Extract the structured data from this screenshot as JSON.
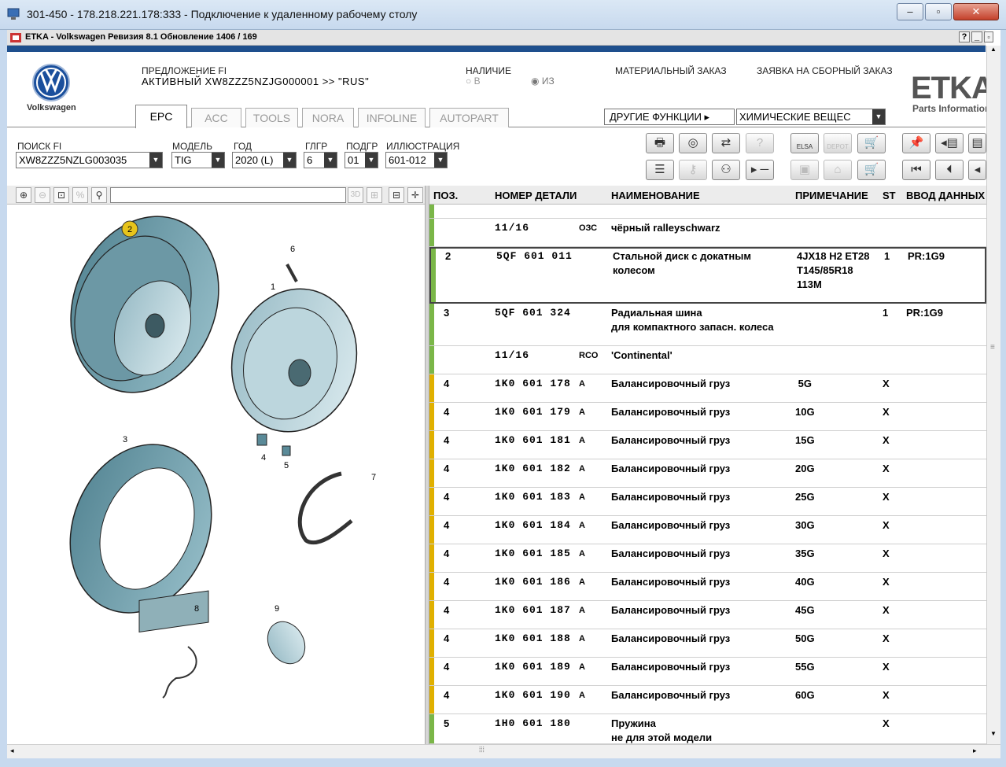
{
  "window": {
    "title": "301-450 - 178.218.221.178:333 - Подключение к удаленному рабочему столу"
  },
  "app": {
    "title": "ETKA - Volkswagen Ревизия 8.1 Обновление 1406 / 169",
    "help": "?",
    "minimize": "_",
    "maximize": "▫"
  },
  "brand": {
    "logo_text": "Volkswagen",
    "etka": "ETKA",
    "etka_sub": "Parts Information"
  },
  "header": {
    "offer_label": "ПРЕДЛОЖЕНИЕ FI",
    "offer_value": "АКТИВНЫЙ XW8ZZZ5NZJG000001 >> \"RUS\"",
    "availability_label": "НАЛИЧИЕ",
    "radio_v": "В",
    "radio_iz": "ИЗ",
    "material_order": "МАТЕРИАЛЬНЫЙ ЗАКАЗ",
    "assembly_order": "ЗАЯВКА НА СБОРНЫЙ ЗАКАЗ",
    "other_functions": "ДРУГИЕ ФУНКЦИИ ▸",
    "chemicals": "ХИМИЧЕСКИЕ ВЕЩЕС"
  },
  "tabs": [
    "EPC",
    "ACC",
    "TOOLS",
    "NORA",
    "INFOLINE",
    "AUTOPART"
  ],
  "search": {
    "fi_label": "ПОИСК FI",
    "fi_value": "XW8ZZZ5NZLG003035",
    "model_label": "МОДЕЛЬ",
    "model_value": "TIG",
    "year_label": "ГОД",
    "year_value": "2020 (L)",
    "glgr_label": "ГЛГР",
    "glgr_value": "6",
    "podgr_label": "ПОДГР",
    "podgr_value": "01",
    "ill_label": "ИЛЛЮСТРАЦИЯ",
    "ill_value": "601-012"
  },
  "toolbar": {
    "elsa": "ELSA",
    "depot": "DEPOT"
  },
  "columns": {
    "pos": "ПОЗ.",
    "part": "НОМЕР ДЕТАЛИ",
    "name": "НАИМЕНОВАНИЕ",
    "note": "ПРИМЕЧАНИЕ",
    "st": "ST",
    "entry": "ВВОД ДАННЫХ"
  },
  "rows": [
    {
      "pos": "",
      "part": "",
      "code": "",
      "name": "",
      "note": "",
      "st": "",
      "entry": ""
    },
    {
      "pos": "",
      "part": "11/16",
      "code": "ОЗС",
      "name": "чёрный ralleyschwarz",
      "note": "",
      "st": "",
      "entry": ""
    },
    {
      "pos": "2",
      "part": "5QF 601 011",
      "code": "",
      "name": "Стальной диск с докатным",
      "name2": "колесом",
      "note": "4JX18 H2 ET28",
      "note2": "T145/85R18",
      "note3": "113M",
      "st": "1",
      "entry": "PR:1G9"
    },
    {
      "pos": "3",
      "part": "5QF 601 324",
      "code": "",
      "name": "Радиальная шина",
      "name2": "для компактного запасн. колеса",
      "note": "",
      "st": "1",
      "entry": "PR:1G9"
    },
    {
      "pos": "",
      "part": "11/16",
      "code": "RCO",
      "name": "'Continental'",
      "note": "",
      "st": "",
      "entry": ""
    },
    {
      "pos": "4",
      "part": "1K0 601 178",
      "code": "A",
      "name": "Балансировочный груз",
      "note": " 5G",
      "st": "X",
      "entry": ""
    },
    {
      "pos": "4",
      "part": "1K0 601 179",
      "code": "A",
      "name": "Балансировочный груз",
      "note": "10G",
      "st": "X",
      "entry": ""
    },
    {
      "pos": "4",
      "part": "1K0 601 181",
      "code": "A",
      "name": "Балансировочный груз",
      "note": "15G",
      "st": "X",
      "entry": ""
    },
    {
      "pos": "4",
      "part": "1K0 601 182",
      "code": "A",
      "name": "Балансировочный груз",
      "note": "20G",
      "st": "X",
      "entry": ""
    },
    {
      "pos": "4",
      "part": "1K0 601 183",
      "code": "A",
      "name": "Балансировочный груз",
      "note": "25G",
      "st": "X",
      "entry": ""
    },
    {
      "pos": "4",
      "part": "1K0 601 184",
      "code": "A",
      "name": "Балансировочный груз",
      "note": "30G",
      "st": "X",
      "entry": ""
    },
    {
      "pos": "4",
      "part": "1K0 601 185",
      "code": "A",
      "name": "Балансировочный груз",
      "note": "35G",
      "st": "X",
      "entry": ""
    },
    {
      "pos": "4",
      "part": "1K0 601 186",
      "code": "A",
      "name": "Балансировочный груз",
      "note": "40G",
      "st": "X",
      "entry": ""
    },
    {
      "pos": "4",
      "part": "1K0 601 187",
      "code": "A",
      "name": "Балансировочный груз",
      "note": "45G",
      "st": "X",
      "entry": ""
    },
    {
      "pos": "4",
      "part": "1K0 601 188",
      "code": "A",
      "name": "Балансировочный груз",
      "note": "50G",
      "st": "X",
      "entry": ""
    },
    {
      "pos": "4",
      "part": "1K0 601 189",
      "code": "A",
      "name": "Балансировочный груз",
      "note": "55G",
      "st": "X",
      "entry": ""
    },
    {
      "pos": "4",
      "part": "1K0 601 190",
      "code": "A",
      "name": "Балансировочный груз",
      "note": "60G",
      "st": "X",
      "entry": ""
    },
    {
      "pos": "5",
      "part": "1H0 601 180",
      "code": "",
      "name": "Пружина",
      "name2": "не для этой модели",
      "note": "",
      "st": "X",
      "entry": ""
    }
  ],
  "diagram": {
    "callouts": [
      "1",
      "2",
      "3",
      "4",
      "5",
      "6",
      "7",
      "8",
      "9"
    ]
  },
  "colors": {
    "green_bar": "#7ab648",
    "yellow_bar": "#e0b000",
    "highlight": "#e7c41c"
  }
}
